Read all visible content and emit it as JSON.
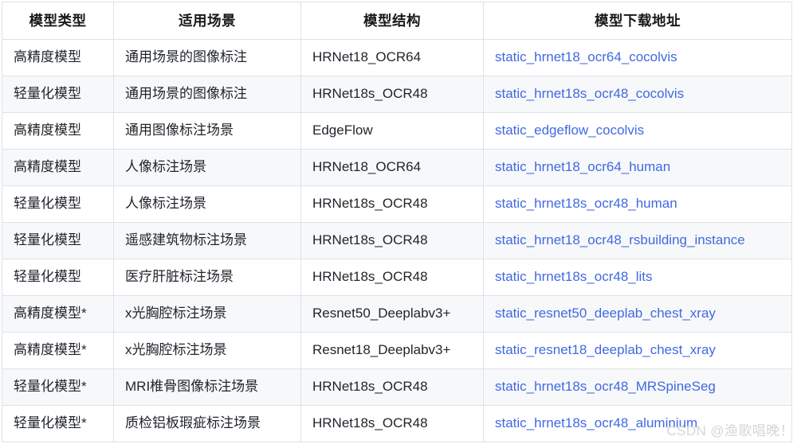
{
  "table": {
    "headers": [
      "模型类型",
      "适用场景",
      "模型结构",
      "模型下载地址"
    ],
    "rows": [
      {
        "model_type": "高精度模型",
        "scene": "通用场景的图像标注",
        "structure": "HRNet18_OCR64",
        "download": "static_hrnet18_ocr64_cocolvis"
      },
      {
        "model_type": "轻量化模型",
        "scene": "通用场景的图像标注",
        "structure": "HRNet18s_OCR48",
        "download": "static_hrnet18s_ocr48_cocolvis"
      },
      {
        "model_type": "高精度模型",
        "scene": "通用图像标注场景",
        "structure": "EdgeFlow",
        "download": "static_edgeflow_cocolvis"
      },
      {
        "model_type": "高精度模型",
        "scene": "人像标注场景",
        "structure": "HRNet18_OCR64",
        "download": "static_hrnet18_ocr64_human"
      },
      {
        "model_type": "轻量化模型",
        "scene": "人像标注场景",
        "structure": "HRNet18s_OCR48",
        "download": "static_hrnet18s_ocr48_human"
      },
      {
        "model_type": "轻量化模型",
        "scene": "遥感建筑物标注场景",
        "structure": "HRNet18s_OCR48",
        "download": "static_hrnet18_ocr48_rsbuilding_instance"
      },
      {
        "model_type": "轻量化模型",
        "scene": "医疗肝脏标注场景",
        "structure": "HRNet18s_OCR48",
        "download": "static_hrnet18s_ocr48_lits"
      },
      {
        "model_type": "高精度模型*",
        "scene": "x光胸腔标注场景",
        "structure": "Resnet50_Deeplabv3+",
        "download": "static_resnet50_deeplab_chest_xray"
      },
      {
        "model_type": "高精度模型*",
        "scene": "x光胸腔标注场景",
        "structure": "Resnet18_Deeplabv3+",
        "download": "static_resnet18_deeplab_chest_xray"
      },
      {
        "model_type": "轻量化模型*",
        "scene": "MRI椎骨图像标注场景",
        "structure": "HRNet18s_OCR48",
        "download": "static_hrnet18s_ocr48_MRSpineSeg"
      },
      {
        "model_type": "轻量化模型*",
        "scene": "质检铝板瑕疵标注场景",
        "structure": "HRNet18s_OCR48",
        "download": "static_hrnet18s_ocr48_aluminium"
      }
    ]
  },
  "watermark": {
    "text": "CSDN @渔歌唱晚！"
  },
  "colors": {
    "link": "#4169e1",
    "border": "#dfe2e8",
    "row_alt": "#f7f8fa",
    "text": "#1f2329",
    "watermark": "#d3d6dc"
  }
}
